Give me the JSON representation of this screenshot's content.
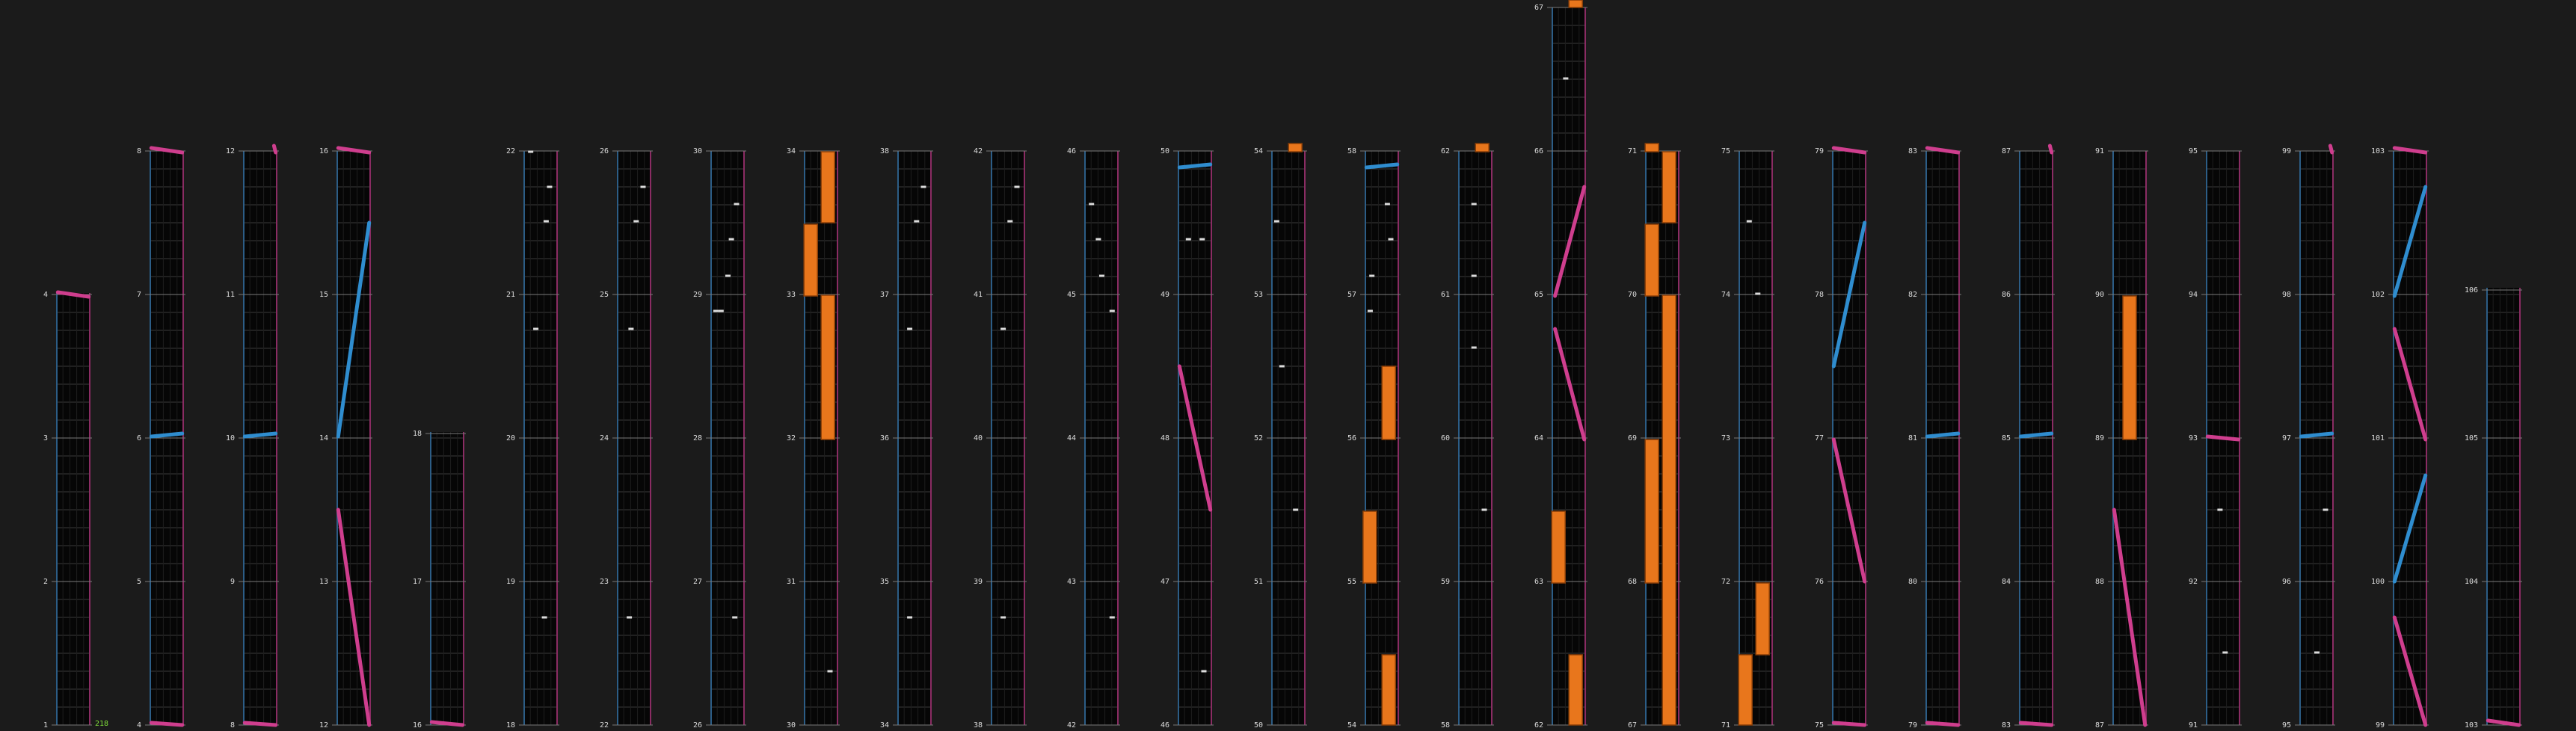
{
  "view": "chart-preview",
  "colors": {
    "background": "#1b1b1b",
    "column_bg": "#060606",
    "grid": "#3a3a3a",
    "measure_line": "#7a7a7a",
    "left_rail": "#2c5d86",
    "right_rail": "#8a2c63",
    "tap_note": "#dcdcdc",
    "hold": "#e8761c",
    "slide_blue": "#2f8dcf",
    "slide_pink": "#cf3e8e",
    "label": "#dcdcdc",
    "combo": "#7fdc3a"
  },
  "combo_count": "218",
  "columns": [
    {
      "measures": [
        "1",
        "2",
        "3",
        "4"
      ],
      "shading": "dark"
    },
    {
      "measures": [
        "4",
        "5",
        "6",
        "7",
        "8"
      ]
    },
    {
      "measures": [
        "8",
        "9",
        "10",
        "11",
        "12"
      ]
    },
    {
      "measures": [
        "12",
        "13",
        "14",
        "15",
        "16"
      ]
    },
    {
      "measures": [
        "16",
        "17",
        "18"
      ]
    },
    {
      "measures": [
        "18",
        "19",
        "20",
        "21",
        "22"
      ]
    },
    {
      "measures": [
        "22",
        "23",
        "24",
        "25",
        "26"
      ]
    },
    {
      "measures": [
        "26",
        "27",
        "28",
        "29",
        "30"
      ]
    },
    {
      "measures": [
        "30",
        "31",
        "32",
        "33",
        "34"
      ]
    },
    {
      "measures": [
        "34",
        "35",
        "36",
        "37",
        "38"
      ]
    },
    {
      "measures": [
        "38",
        "39",
        "40",
        "41",
        "42"
      ]
    },
    {
      "measures": [
        "42",
        "43",
        "44",
        "45",
        "46"
      ]
    },
    {
      "measures": [
        "46",
        "47",
        "48",
        "49",
        "50"
      ]
    },
    {
      "measures": [
        "50",
        "51",
        "52",
        "53",
        "54"
      ]
    },
    {
      "measures": [
        "54",
        "55",
        "56",
        "57",
        "58"
      ]
    },
    {
      "measures": [
        "58",
        "59",
        "60",
        "61",
        "62"
      ]
    },
    {
      "measures": [
        "62",
        "63",
        "64",
        "65",
        "66",
        "67"
      ]
    },
    {
      "measures": [
        "67",
        "68",
        "69",
        "70",
        "71"
      ]
    },
    {
      "measures": [
        "71",
        "72",
        "73",
        "74",
        "75"
      ]
    },
    {
      "measures": [
        "75",
        "76",
        "77",
        "78",
        "79"
      ]
    },
    {
      "measures": [
        "79",
        "80",
        "81",
        "82",
        "83"
      ]
    },
    {
      "measures": [
        "83",
        "84",
        "85",
        "86",
        "87"
      ]
    },
    {
      "measures": [
        "87",
        "88",
        "89",
        "90",
        "91"
      ]
    },
    {
      "measures": [
        "91",
        "92",
        "93",
        "94",
        "95"
      ]
    },
    {
      "measures": [
        "95",
        "96",
        "97",
        "98",
        "99"
      ]
    },
    {
      "measures": [
        "99",
        "100",
        "101",
        "102",
        "103"
      ]
    },
    {
      "measures": [
        "103",
        "104",
        "105",
        "106"
      ]
    }
  ]
}
